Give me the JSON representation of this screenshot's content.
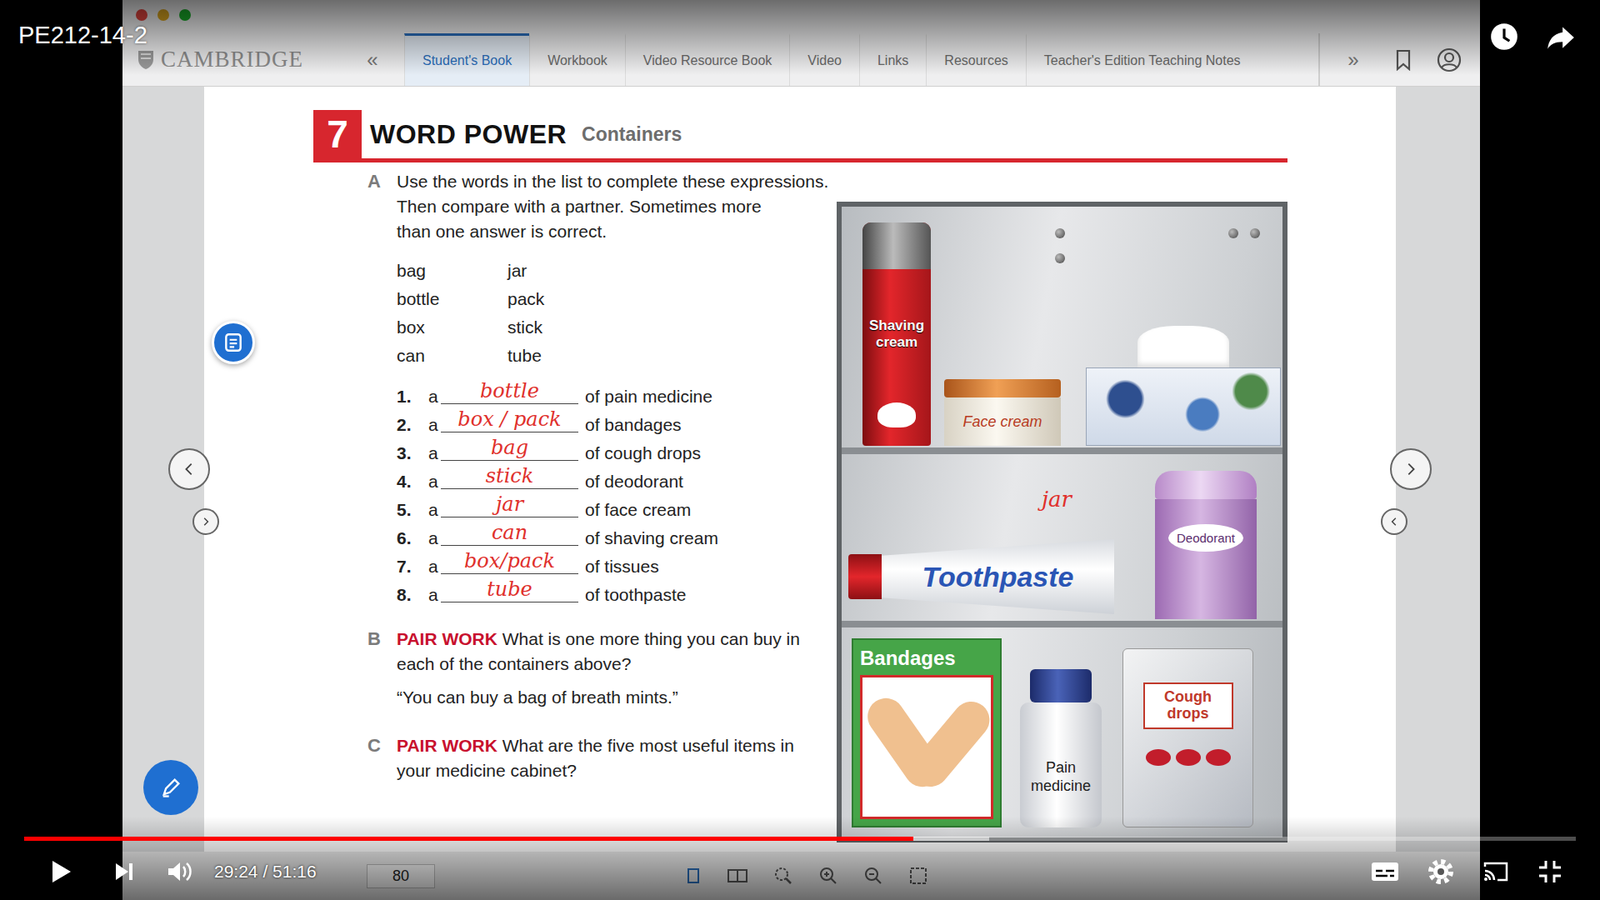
{
  "player": {
    "title": "PE212-14-2",
    "time": "29:24 / 51:16",
    "progress": {
      "level": 0.573,
      "buffered": 0.622
    }
  },
  "app": {
    "logo": "CAMBRIDGE",
    "collapse": "«",
    "expand": "»",
    "tabs": [
      {
        "label": "Student's Book",
        "selected": true
      },
      {
        "label": "Workbook",
        "selected": false
      },
      {
        "label": "Video Resource Book",
        "selected": false
      },
      {
        "label": "Video",
        "selected": false
      },
      {
        "label": "Links",
        "selected": false
      },
      {
        "label": "Resources",
        "selected": false
      },
      {
        "label": "Teacher's Edition Teaching Notes",
        "selected": false
      }
    ],
    "page_number": "80"
  },
  "page": {
    "unit": "7",
    "title": "WORD POWER",
    "subtitle": "Containers",
    "exercise_a": {
      "letter": "A",
      "lines": [
        "Use the words in the list to complete these expressions.",
        "Then compare with a partner. Sometimes more",
        "than one answer is correct."
      ],
      "words": [
        "bag",
        "bottle",
        "box",
        "can",
        "jar",
        "pack",
        "stick",
        "tube"
      ],
      "items": [
        {
          "number": "1.",
          "article": "a",
          "answer": "bottle",
          "phrase": "of pain medicine"
        },
        {
          "number": "2.",
          "article": "a",
          "answer": "box / pack",
          "phrase": "of bandages"
        },
        {
          "number": "3.",
          "article": "a",
          "answer": "bag",
          "phrase": "of cough drops"
        },
        {
          "number": "4.",
          "article": "a",
          "answer": "stick",
          "phrase": "of deodorant"
        },
        {
          "number": "5.",
          "article": "a",
          "answer": "jar",
          "phrase": "of face cream"
        },
        {
          "number": "6.",
          "article": "a",
          "answer": "can",
          "phrase": "of shaving cream"
        },
        {
          "number": "7.",
          "article": "a",
          "answer": "box/pack",
          "phrase": "of tissues"
        },
        {
          "number": "8.",
          "article": "a",
          "answer": "tube",
          "phrase": "of toothpaste"
        }
      ]
    },
    "exercise_b": {
      "letter": "B",
      "label": "PAIR WORK",
      "text": "What is one more thing you can buy in each of the containers above?",
      "example": "“You can buy a bag of breath mints.”"
    },
    "exercise_c": {
      "letter": "C",
      "label": "PAIR WORK",
      "text": "What are the five most useful items in your medicine cabinet?"
    }
  },
  "cabinet": {
    "note": "jar",
    "shelves": [
      {
        "items": [
          {
            "kind": "can",
            "label": "Shaving cream"
          },
          {
            "kind": "jar",
            "label": "Face cream"
          },
          {
            "kind": "tissues"
          }
        ]
      },
      {
        "items": [
          {
            "kind": "tube",
            "label": "Toothpaste"
          },
          {
            "kind": "stick",
            "label": "Deodorant"
          }
        ]
      },
      {
        "items": [
          {
            "kind": "box",
            "label": "Bandages"
          },
          {
            "kind": "bottle",
            "label": "Pain medicine"
          },
          {
            "kind": "bag",
            "label": "Cough drops"
          }
        ]
      }
    ]
  }
}
